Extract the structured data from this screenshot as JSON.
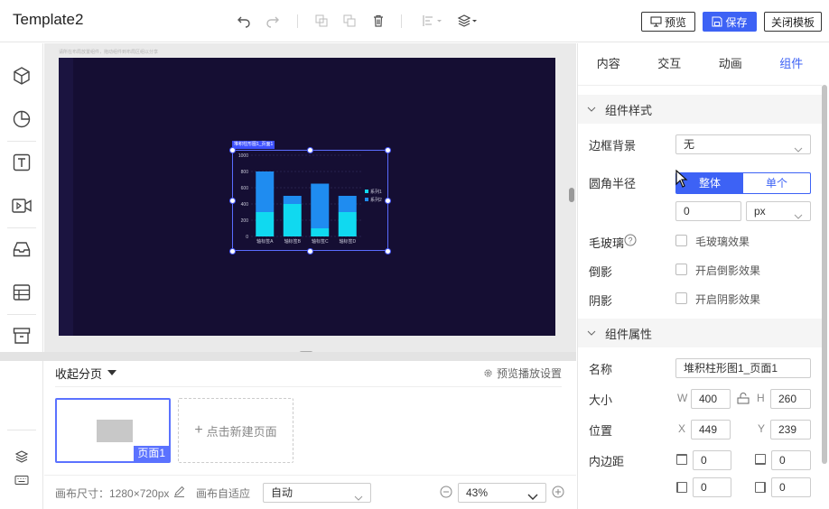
{
  "app_title": "Template2",
  "toolbar": {
    "undo_icon": "undo-icon",
    "redo_icon": "redo-icon",
    "copy_icon": "copy-icon",
    "paste_icon": "paste-icon",
    "delete_icon": "trash-icon",
    "align_icon": "align-icon",
    "layer_icon": "layers-icon",
    "preview_label": "预览",
    "save_label": "保存",
    "close_template_label": "关闭模板"
  },
  "sidebar": {
    "items": [
      {
        "icon": "cube-icon"
      },
      {
        "icon": "pie-chart-icon"
      },
      {
        "icon": "text-icon"
      },
      {
        "icon": "video-icon"
      },
      {
        "icon": "inbox-icon"
      },
      {
        "icon": "table-icon"
      },
      {
        "icon": "archive-icon"
      }
    ],
    "bottom_icons": [
      "layers-icon",
      "keyboard-icon"
    ]
  },
  "canvas": {
    "hint_text": "请所在布局放置组件，拖动组件到布局区组以分享",
    "chart_tag": "堆积柱形图1_页面1"
  },
  "chart_data": {
    "type": "bar",
    "stacked": true,
    "categories": [
      "轴标签A",
      "轴标签B",
      "轴标签C",
      "轴标签D"
    ],
    "series": [
      {
        "name": "系列1",
        "values": [
          300,
          400,
          100,
          300
        ],
        "color": "#10d9f0"
      },
      {
        "name": "系列2",
        "values": [
          500,
          100,
          550,
          200
        ],
        "color": "#1f8cf0"
      }
    ],
    "ylim": [
      0,
      1000
    ],
    "yticks": [
      0,
      200,
      400,
      600,
      800,
      1000
    ],
    "legend": "right"
  },
  "pages": {
    "toggle_label": "收起分页",
    "settings_label": "预览播放设置",
    "thumbnail_label": "页面1",
    "new_page_label": "点击新建页面"
  },
  "status": {
    "canvas_size_label": "画布尺寸：1280×720px",
    "adapt_label": "画布自适应",
    "adapt_value": "自动",
    "zoom_value": "43%"
  },
  "panel": {
    "tabs": [
      "内容",
      "交互",
      "动画",
      "组件"
    ],
    "active_tab": 3,
    "style_section": "组件样式",
    "border_bg_label": "边框背景",
    "border_bg_value": "无",
    "radius_label": "圆角半径",
    "radius_whole": "整体",
    "radius_single": "单个",
    "radius_value": "0",
    "radius_unit": "px",
    "frost_label": "毛玻璃",
    "frost_check": "毛玻璃效果",
    "reflect_label": "倒影",
    "reflect_check": "开启倒影效果",
    "shadow_label": "阴影",
    "shadow_check": "开启阴影效果",
    "attr_section": "组件属性",
    "name_label": "名称",
    "name_value": "堆积柱形图1_页面1",
    "size_label": "大小",
    "width_letter": "W",
    "width_value": "400",
    "height_letter": "H",
    "height_value": "260",
    "position_label": "位置",
    "x_letter": "X",
    "x_value": "449",
    "y_letter": "Y",
    "y_value": "239",
    "padding_label": "内边距",
    "pad_top": "0",
    "pad_bottom": "0",
    "pad_left": "0",
    "pad_right": "0"
  }
}
